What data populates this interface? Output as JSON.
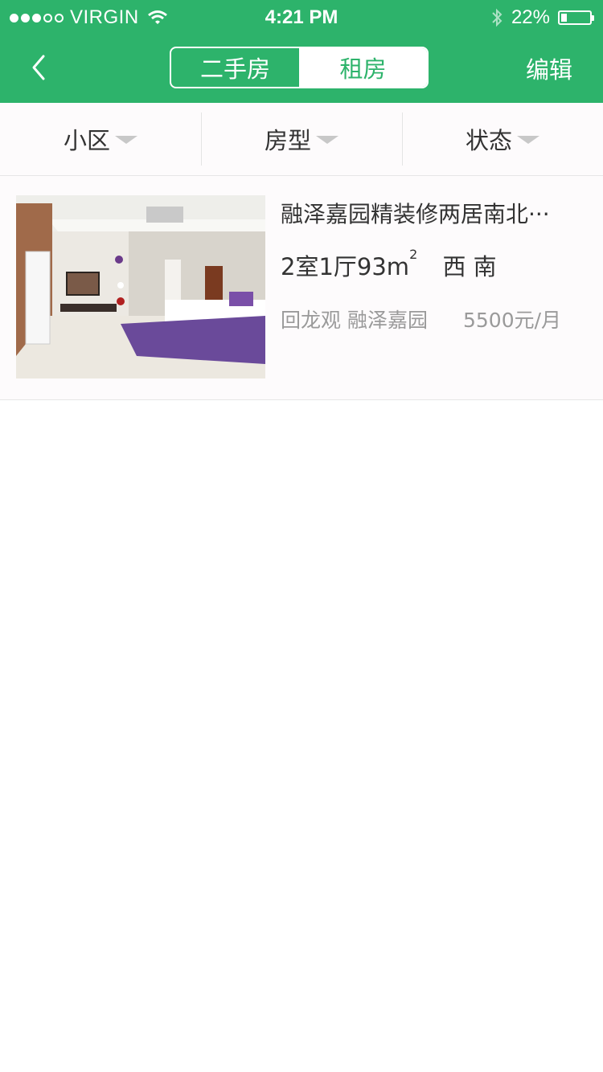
{
  "status_bar": {
    "carrier": "VIRGIN",
    "time": "4:21 PM",
    "battery_text": "22%",
    "battery_level": 0.22
  },
  "nav": {
    "tabs": [
      {
        "label": "二手房",
        "active": false
      },
      {
        "label": "租房",
        "active": true
      }
    ],
    "edit_label": "编辑"
  },
  "filters": [
    {
      "label": "小区"
    },
    {
      "label": "房型"
    },
    {
      "label": "状态"
    }
  ],
  "listings": [
    {
      "title": "融泽嘉园精装修两居南北···",
      "layout": "2室1厅93m",
      "area_sup": "2",
      "orientation": "西 南",
      "district": "回龙观",
      "community": "融泽嘉园",
      "price": "5500元/月",
      "image": "living-room-photo"
    }
  ],
  "colors": {
    "accent": "#2db36b",
    "text": "#333333",
    "muted": "#9a9a9a"
  }
}
